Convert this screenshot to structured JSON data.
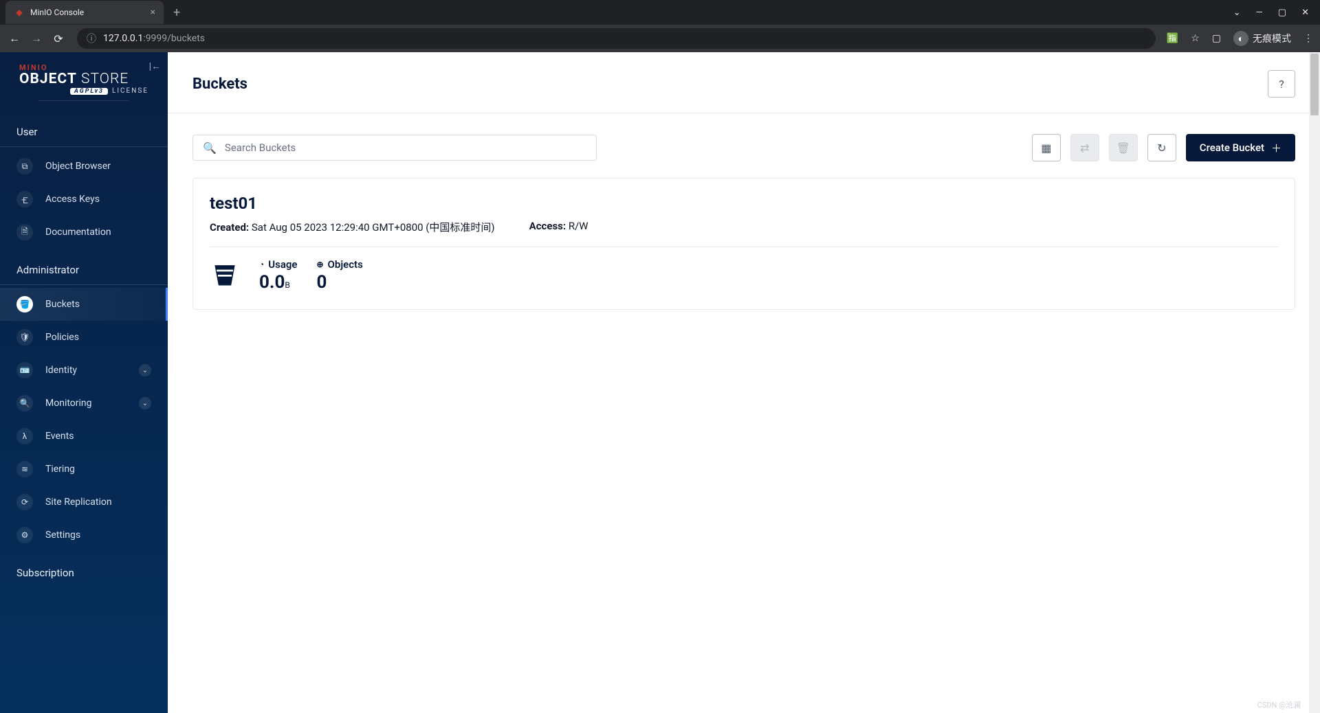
{
  "browser": {
    "tab_title": "MinIO Console",
    "url_info_icon": "ⓘ",
    "url_host": "127.0.0.1",
    "url_rest": ":9999/buckets",
    "incognito_label": "无痕模式"
  },
  "logo": {
    "brand": "MINIO",
    "main_bold": "OBJECT",
    "main_light": "STORE",
    "ag_badge": "AGPLv3",
    "license": "LICENSE"
  },
  "sidebar": {
    "section_user": "User",
    "section_admin": "Administrator",
    "subscription": "Subscription",
    "items_user": [
      {
        "icon": "⧉",
        "label": "Object Browser"
      },
      {
        "icon": "🝗",
        "label": "Access Keys"
      },
      {
        "icon": "🗎",
        "label": "Documentation"
      }
    ],
    "items_admin": [
      {
        "icon": "🪣",
        "label": "Buckets",
        "active": true
      },
      {
        "icon": "🛡",
        "label": "Policies"
      },
      {
        "icon": "🪪",
        "label": "Identity",
        "expandable": true
      },
      {
        "icon": "🔍",
        "label": "Monitoring",
        "expandable": true
      },
      {
        "icon": "λ",
        "label": "Events"
      },
      {
        "icon": "≋",
        "label": "Tiering"
      },
      {
        "icon": "⟳",
        "label": "Site Replication"
      },
      {
        "icon": "⚙",
        "label": "Settings"
      }
    ]
  },
  "page": {
    "title": "Buckets",
    "search_placeholder": "Search Buckets",
    "create_label": "Create Bucket"
  },
  "bucket": {
    "name": "test01",
    "created_label": "Created:",
    "created_value": "Sat Aug 05 2023 12:29:40 GMT+0800 (中国标准时间)",
    "access_label": "Access:",
    "access_value": "R/W",
    "usage_label": "Usage",
    "usage_value": "0.0",
    "usage_unit": "B",
    "objects_label": "Objects",
    "objects_value": "0"
  },
  "watermark": "CSDN @沧澜"
}
